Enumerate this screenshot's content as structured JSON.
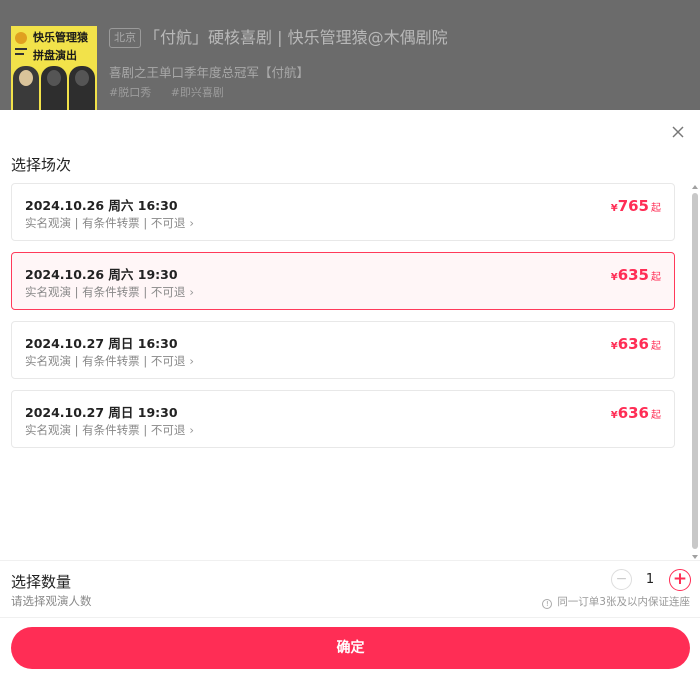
{
  "header": {
    "poster": {
      "line1": "快乐管理猿",
      "line2": "拼盘演出"
    },
    "city": "北京",
    "title": "「付航」硬核喜剧 | 快乐管理猿@木偶剧院",
    "subtitle": "喜剧之王单口季年度总冠军【付航】",
    "tags": [
      "#脱口秀",
      "#即兴喜剧"
    ]
  },
  "sheet": {
    "section_title": "选择场次",
    "sessions": [
      {
        "date": "2024.10.26 周六 16:30",
        "rules": "实名观演 | 有条件转票 | 不可退",
        "currency": "¥",
        "price": "765",
        "suffix": "起",
        "selected": false
      },
      {
        "date": "2024.10.26 周六 19:30",
        "rules": "实名观演 | 有条件转票 | 不可退",
        "currency": "¥",
        "price": "635",
        "suffix": "起",
        "selected": true
      },
      {
        "date": "2024.10.27 周日 16:30",
        "rules": "实名观演 | 有条件转票 | 不可退",
        "currency": "¥",
        "price": "636",
        "suffix": "起",
        "selected": false
      },
      {
        "date": "2024.10.27 周日 19:30",
        "rules": "实名观演 | 有条件转票 | 不可退",
        "currency": "¥",
        "price": "636",
        "suffix": "起",
        "selected": false
      }
    ],
    "quantity": {
      "title": "选择数量",
      "subtitle": "请选择观演人数",
      "minus": "−",
      "value": "1",
      "plus": "+",
      "note": "同一订单3张及以内保证连座"
    },
    "confirm_label": "确定"
  },
  "colors": {
    "accent": "#ff2d55",
    "selected_bg": "#fff6f7",
    "overlay": "#6b6b6b"
  }
}
